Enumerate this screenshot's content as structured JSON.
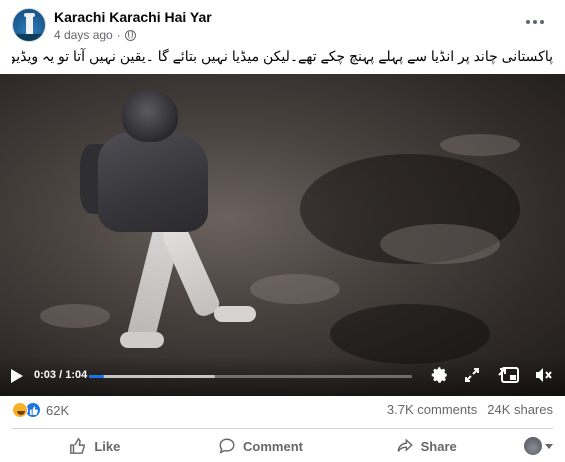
{
  "header": {
    "page_name": "Karachi Karachi Hai Yar",
    "timestamp": "4 days ago",
    "audience_icon": "globe-icon",
    "more_icon": "more-options-icon"
  },
  "caption": "پاکستانی چاند پر انڈیا سے پہلے پہنچ چکے تھے۔لیکن میڈیا نہیں بتائے گا ۔یقین نہیں آتا تو یہ ویڈیو دیکھ لیں",
  "video": {
    "current_time": "0:03",
    "duration": "1:04",
    "progress": 0.047,
    "buffered": 0.39,
    "controls": [
      "play-icon",
      "settings-icon",
      "fullscreen-icon",
      "expand-icon",
      "pip-icon",
      "volume-icon"
    ]
  },
  "stats": {
    "reaction_icons": [
      "haha-icon",
      "like-icon"
    ],
    "reaction_count": "62K",
    "comments": "3.7K comments",
    "shares": "24K shares"
  },
  "actions": {
    "like_label": "Like",
    "comment_label": "Comment",
    "share_label": "Share"
  },
  "colors": {
    "accent": "#1b74e4",
    "secondary_text": "#65676b"
  }
}
